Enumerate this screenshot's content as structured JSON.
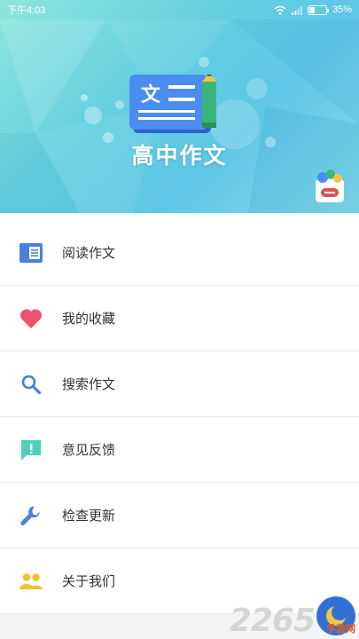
{
  "status_bar": {
    "time": "下午4:03",
    "battery": "35%",
    "battery_level": 0.35
  },
  "header": {
    "logo_glyph": "文",
    "app_title": "高中作文",
    "colors": {
      "banner_start": "#8ee6dc",
      "banner_end": "#5fc7e6",
      "logo_blue": "#3d7ee6",
      "logo_green": "#3bb57a"
    }
  },
  "menu": {
    "items": [
      {
        "label": "阅读作文",
        "icon": "book-icon",
        "color": "#4a7fdc"
      },
      {
        "label": "我的收藏",
        "icon": "heart-icon",
        "color": "#e8546b"
      },
      {
        "label": "搜索作文",
        "icon": "search-icon",
        "color": "#4a7fdc"
      },
      {
        "label": "意见反馈",
        "icon": "feedback-icon",
        "color": "#4fd1b9"
      },
      {
        "label": "检查更新",
        "icon": "wrench-icon",
        "color": "#4a7fdc"
      },
      {
        "label": "关于我们",
        "icon": "people-icon",
        "color": "#f2c22a"
      }
    ]
  },
  "watermark": {
    "number": "2265",
    "site": "手游网"
  }
}
